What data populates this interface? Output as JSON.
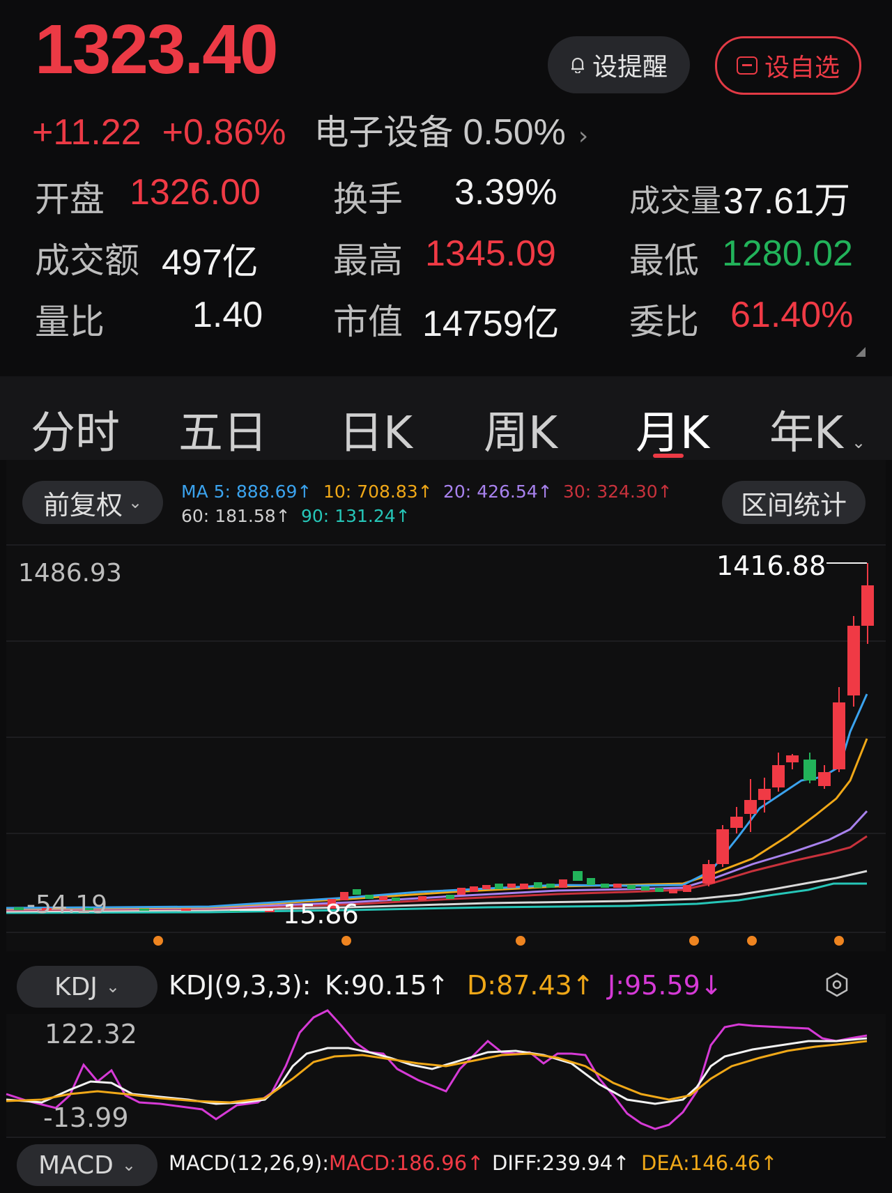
{
  "header": {
    "price": "1323.40",
    "change": "+11.22",
    "change_pct": "+0.86%",
    "sector_name": "电子设备",
    "sector_pct": "0.50%",
    "alert_label": "设提醒",
    "fav_label": "设自选"
  },
  "stats": [
    {
      "label": "开盘",
      "value": "1326.00",
      "color": "red"
    },
    {
      "label": "换手",
      "value": "3.39%",
      "color": "white"
    },
    {
      "label": "成交量",
      "value": "37.61万",
      "color": "white"
    },
    {
      "label": "成交额",
      "value": "497亿",
      "color": "white"
    },
    {
      "label": "最高",
      "value": "1345.09",
      "color": "red"
    },
    {
      "label": "最低",
      "value": "1280.02",
      "color": "green"
    },
    {
      "label": "量比",
      "value": "1.40",
      "color": "white"
    },
    {
      "label": "市值",
      "value": "14759亿",
      "color": "white"
    },
    {
      "label": "委比",
      "value": "61.40%",
      "color": "red"
    }
  ],
  "tabs": [
    {
      "label": "分时"
    },
    {
      "label": "五日"
    },
    {
      "label": "日K"
    },
    {
      "label": "周K"
    },
    {
      "label": "月K",
      "active": true
    },
    {
      "label": "年K"
    }
  ],
  "chart_toolbar": {
    "adjust_label": "前复权",
    "range_label": "区间统计",
    "ma": [
      {
        "label": "MA 5:",
        "value": "888.69↑",
        "color": "#3ba3ee"
      },
      {
        "label": "10:",
        "value": "708.83↑",
        "color": "#f0a818"
      },
      {
        "label": "20:",
        "value": "426.54↑",
        "color": "#a882ee"
      },
      {
        "label": "30:",
        "value": "324.30↑",
        "color": "#c8323c"
      },
      {
        "label": "60:",
        "value": "181.58↑",
        "color": "#cfcfcf"
      },
      {
        "label": "90:",
        "value": "131.24↑",
        "color": "#26c6b8"
      }
    ]
  },
  "chart_data": {
    "type": "candlestick",
    "y_max_label": "1486.93",
    "y_min_label": "-54.19",
    "y_range": [
      -54.19,
      1486.93
    ],
    "high_marker": "1416.88",
    "low_marker": "15.86"
  },
  "kdj": {
    "selector_label": "KDJ",
    "params": "KDJ(9,3,3):",
    "k": "K:90.15↑",
    "d": "D:87.43↑",
    "j": "J:95.59↓",
    "y_max_label": "122.32",
    "y_min_label": "-13.99"
  },
  "macd": {
    "selector_label": "MACD",
    "params": "MACD(12,26,9):",
    "macd": "MACD:186.96↑",
    "diff": "DIFF:239.94↑",
    "dea": "DEA:146.46↑"
  }
}
